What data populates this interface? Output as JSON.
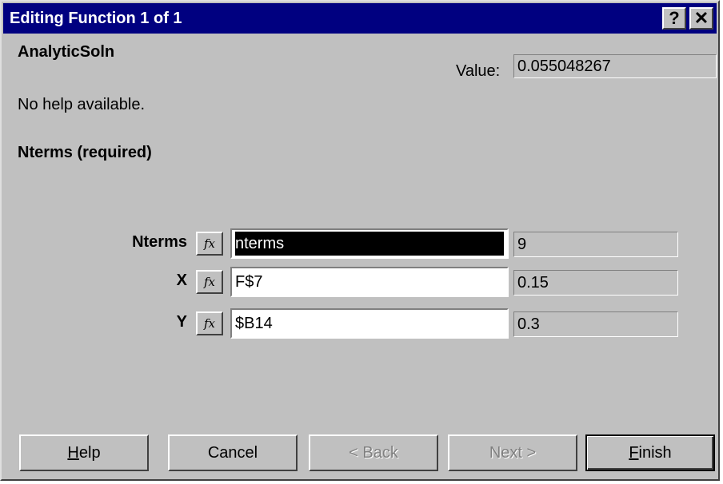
{
  "window": {
    "title": "Editing Function 1 of 1",
    "help_button": "?",
    "close_button": "✕"
  },
  "function": {
    "name": "AnalyticSoln",
    "value_label": "Value:",
    "value": "0.055048267",
    "help_text": "No help available.",
    "current_argument": "Nterms (required)"
  },
  "arguments": [
    {
      "label": "Nterms",
      "fx": "fx",
      "input": "nterms",
      "value": "9",
      "selected": true
    },
    {
      "label": "X",
      "fx": "fx",
      "input": "F$7",
      "value": "0.15",
      "selected": false
    },
    {
      "label": "Y",
      "fx": "fx",
      "input": "$B14",
      "value": "0.3",
      "selected": false
    }
  ],
  "buttons": {
    "help_pre": "",
    "help_ul": "H",
    "help_post": "elp",
    "cancel": "Cancel",
    "back": "< Back",
    "next": "Next >",
    "finish_pre": "",
    "finish_ul": "F",
    "finish_post": "inish"
  }
}
